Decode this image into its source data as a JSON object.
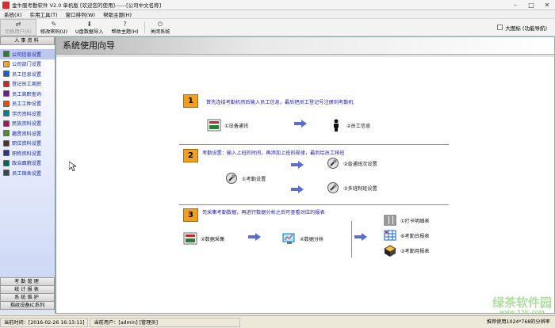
{
  "window": {
    "title": "金牛服考勤软件 V2.0  单机版 [欢迎您的使用]------[公司中文名称]",
    "min": "–",
    "max": "□",
    "close": "✕"
  },
  "menu": [
    "系统(X)",
    "实用工具(T)",
    "窗口排列(W)",
    "帮助主题(H)"
  ],
  "toolbar": {
    "items": [
      "切换用户(R)",
      "修改密码(U)",
      "U盘数据导入",
      "帮助主题(H)",
      "关闭系统"
    ],
    "icons": [
      "⇄",
      "✎",
      "⬇",
      "?",
      "⏻"
    ],
    "big_icon_label": "大图标 (功能导航)"
  },
  "sidebar": {
    "header": "人事资料",
    "items": [
      {
        "label": "公司信息设置",
        "color": "#2e7d32"
      },
      {
        "label": "公司部门设置",
        "color": "#f9a825"
      },
      {
        "label": "员工信息设置",
        "color": "#1565c0"
      },
      {
        "label": "登记员工离职",
        "color": "#c62828"
      },
      {
        "label": "员工离职查询",
        "color": "#6a1b9a"
      },
      {
        "label": "员工工种设置",
        "color": "#e65100"
      },
      {
        "label": "学历资料设置",
        "color": "#00838f"
      },
      {
        "label": "民族资料设置",
        "color": "#ad1457"
      },
      {
        "label": "籍贯资料设置",
        "color": "#558b2f"
      },
      {
        "label": "职位资料设置",
        "color": "#4e342e"
      },
      {
        "label": "职称资料设置",
        "color": "#283593"
      },
      {
        "label": "政治面貌设置",
        "color": "#00695c"
      },
      {
        "label": "员工宿舍设置",
        "color": "#37474f"
      }
    ],
    "tabs": [
      "考勤管理",
      "统计报表",
      "系统维护",
      "指纹设备IC系列"
    ]
  },
  "main": {
    "title": "系统使用向导",
    "step1": {
      "num": "1",
      "desc": "首先连接考勤机然后输入员工信息，最后把员工登记号注册到考勤机",
      "a": "①设备通讯",
      "b": "②员工信息"
    },
    "step2": {
      "num": "2",
      "desc": "考勤设置：输入上班的时间，再添加上班的规律，最后给员工排班",
      "a": "①考勤设置",
      "b": "②普通班次设置",
      "c": "③多班制班设置"
    },
    "step3": {
      "num": "3",
      "desc": "先采集考勤数据，再进行数据分析之后可查看对应的报表",
      "a": "②数据采集",
      "b": "④数据分析",
      "c": "①打卡明细表",
      "d": "⑥考勤日报表",
      "e": "③考勤月报表"
    }
  },
  "status": {
    "time": "当前时间：[2016-02-26 16:13:11]",
    "user": "当前用户：[admin] [管理员]",
    "hint": "推荐使用1024*768的分辨率"
  },
  "watermark": {
    "line1": "绿茶软件园",
    "line2": "www.33lc.com"
  }
}
